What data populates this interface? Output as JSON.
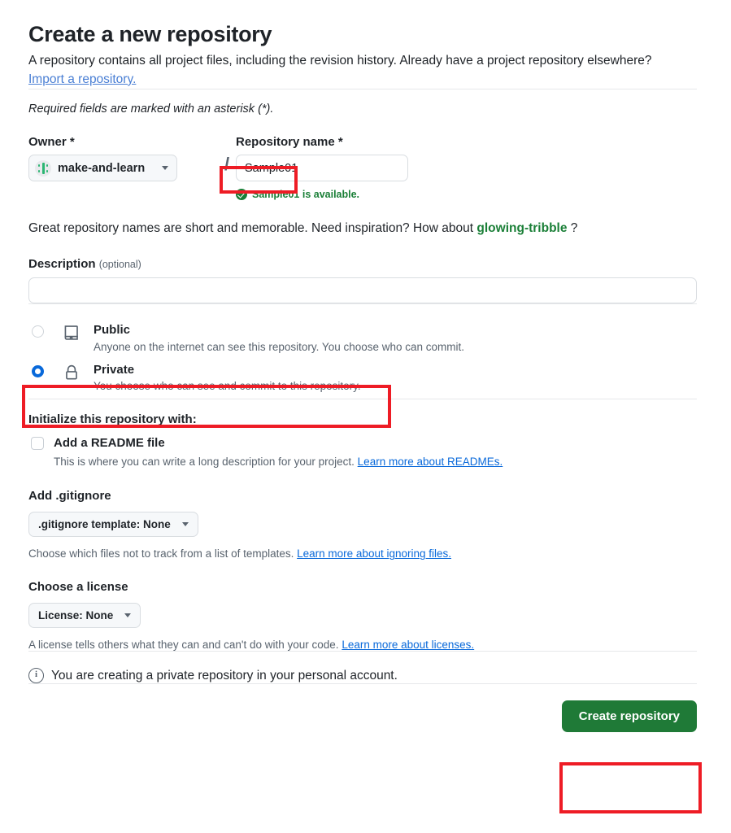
{
  "header": {
    "title": "Create a new repository",
    "description": "A repository contains all project files, including the revision history. Already have a project repository elsewhere?",
    "import_link": "Import a repository."
  },
  "required_note": "Required fields are marked with an asterisk (*).",
  "owner": {
    "label": "Owner *",
    "value": "make-and-learn",
    "separator": "/"
  },
  "repository_name": {
    "label": "Repository name *",
    "value": "Sample01",
    "availability": "Sample01 is available."
  },
  "suggestion": {
    "prefix": "Great repository names are short and memorable. Need inspiration? How about ",
    "name": "glowing-tribble",
    "suffix": " ?"
  },
  "description": {
    "label": "Description",
    "optional": "(optional)",
    "value": "",
    "placeholder": ""
  },
  "visibility": {
    "options": [
      {
        "id": "public",
        "title": "Public",
        "subtitle": "Anyone on the internet can see this repository. You choose who can commit.",
        "selected": false,
        "icon": "repo-icon"
      },
      {
        "id": "private",
        "title": "Private",
        "subtitle": "You choose who can see and commit to this repository.",
        "selected": true,
        "icon": "lock-icon"
      }
    ]
  },
  "initialize": {
    "heading": "Initialize this repository with:",
    "readme": {
      "label": "Add a README file",
      "checked": false,
      "help_prefix": "This is where you can write a long description for your project. ",
      "help_link": "Learn more about READMEs."
    },
    "gitignore": {
      "heading": "Add .gitignore",
      "button_label": ".gitignore template: None",
      "help_prefix": "Choose which files not to track from a list of templates. ",
      "help_link": "Learn more about ignoring files."
    },
    "license": {
      "heading": "Choose a license",
      "button_label": "License: None",
      "help_prefix": "A license tells others what they can and can't do with your code. ",
      "help_link": "Learn more about licenses."
    }
  },
  "notice": {
    "text": "You are creating a private repository in your personal account."
  },
  "footer": {
    "create_label": "Create repository"
  },
  "colors": {
    "accent_green": "#1a7f37",
    "button_green": "#1f7a37",
    "link_blue": "#0969da",
    "radio_blue": "#0969da",
    "annotation_red": "#ee1c25",
    "muted_text": "#59636e"
  }
}
